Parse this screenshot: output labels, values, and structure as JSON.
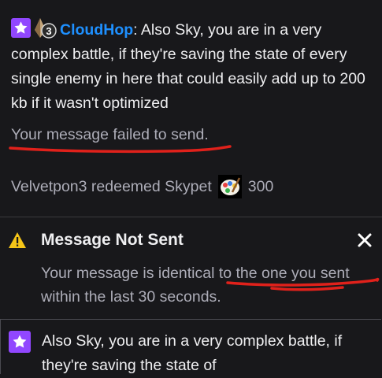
{
  "chat_message": {
    "username": "CloudHop",
    "separator": ":",
    "bits_badge_number": "3",
    "text": " Also Sky, you are in a very complex battle, if they're saving the state of every single enemy in here that could easily add up to 200 kb if it wasn't optimized"
  },
  "failed_notice": "Your message failed to send.",
  "redemption": {
    "text": "Velvetpon3 redeemed Skypet",
    "cost": "300"
  },
  "warning": {
    "title": "Message Not Sent",
    "body": "Your message is identical to the one you sent within the last 30 seconds."
  },
  "preview": {
    "text": "Also Sky, you are in a very complex battle, if they're saving the state of"
  },
  "colors": {
    "background": "#18181b",
    "username": "#1e90ff",
    "sub_badge": "#9147ff",
    "warning": "#f5c518",
    "annotation_red": "#e0211b"
  },
  "icons": [
    "star-badge-icon",
    "bits-badge-icon",
    "skypet-icon",
    "warning-icon",
    "close-icon"
  ]
}
